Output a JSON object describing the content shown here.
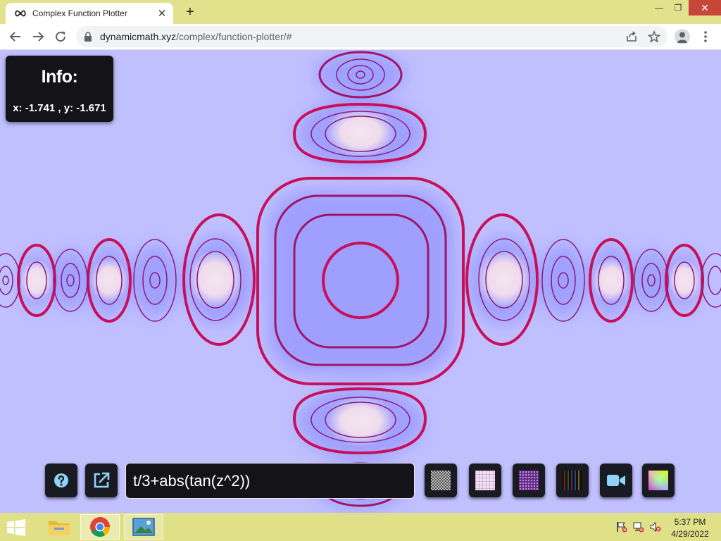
{
  "browser": {
    "tab_title": "Complex Function Plotter",
    "url_host": "dynamicmath.xyz",
    "url_path": "/complex/function-plotter/#"
  },
  "info": {
    "title": "Info:",
    "coords": "x: -1.741 , y: -1.671"
  },
  "controls": {
    "function_value": "t/3+abs(tan(z^2))",
    "buttons": [
      "help-icon",
      "external-link-icon",
      "pattern-checker-icon",
      "pattern-grid-icon",
      "pattern-dots-icon",
      "pattern-stripes-icon",
      "video-camera-icon",
      "color-wheel-icon"
    ]
  },
  "taskbar": {
    "time": "5:37 PM",
    "date": "4/29/2022"
  },
  "colors": {
    "background": "#c0c0ff",
    "contour": "#c8105a",
    "contour_thin": "#8a1a7a",
    "glow": "#8080ff",
    "highlight": "#f0dcec"
  }
}
